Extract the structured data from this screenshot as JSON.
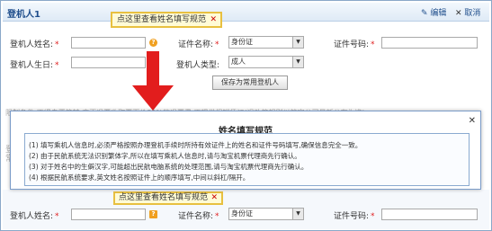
{
  "panel": {
    "title": "登机人1",
    "edit_label": "编辑",
    "cancel_label": "取消"
  },
  "form": {
    "name_label": "登机人姓名:",
    "cert_type_label": "证件名称:",
    "cert_type_value": "身份证",
    "cert_no_label": "证件号码:",
    "birthday_label": "登机人生日:",
    "passenger_type_label": "登机人类型:",
    "passenger_type_value": "成人",
    "save_button": "保存为常用登机人",
    "required_mark": "*"
  },
  "tip": {
    "text": "点这里查看姓名填写规范",
    "close": "✕",
    "icon": "?"
  },
  "obscured": {
    "line1": "限制条件:不得自愿签转,变更退票收取票面价80%的退票费,不提供报销凭证(退改签规则以航空公司最新公布为准)",
    "line2": "登",
    "line3": "常"
  },
  "popup": {
    "title": "姓名填写规范",
    "close": "✕",
    "rules": [
      "(1) 填写乘机人信息时,必须严格按照办理登机手续时所持有效证件上的姓名和证件号码填写,确保信息完全一致。",
      "(2) 由于民航系统无法识别繁体字,所以在填写乘机人信息时,请与淘宝机票代理商先行确认。",
      "(3) 对于姓名中的生僻汉字,可能超出民航电脑系统的处理范围,请与淘宝机票代理商先行确认。",
      "(4) 根据民航系统要求,英文姓名按照证件上的顺序填写,中间以斜杠/隔开。"
    ]
  },
  "second": {
    "tip_text": "点这里查看姓名填写规范",
    "name_label": "登机人姓名:",
    "cert_type_label": "证件名称:",
    "cert_type_value": "身份证",
    "cert_no_label": "证件号码:"
  },
  "colors": {
    "arrow": "#e21d1d",
    "required": "#e02020",
    "tip_border": "#e8c040"
  }
}
